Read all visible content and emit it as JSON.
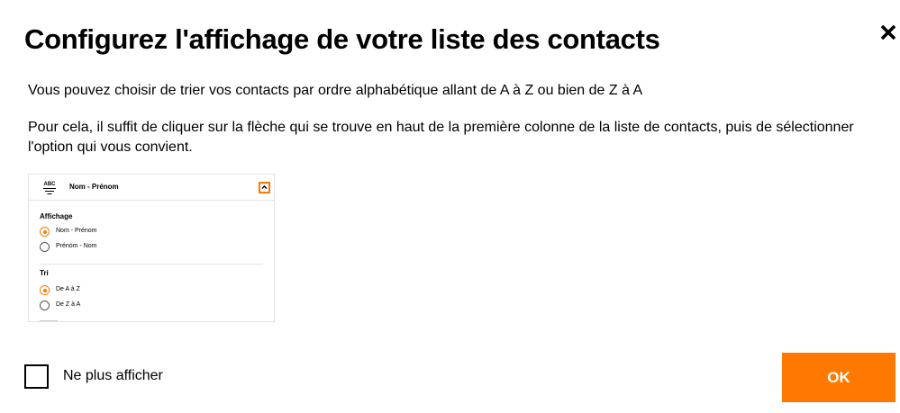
{
  "dialog": {
    "title": "Configurez l'affichage de votre liste des contacts",
    "close_icon": "close-icon",
    "paragraph1": "Vous pouvez choisir de trier vos contacts par ordre alphabétique allant de A à Z ou bien de Z à A",
    "paragraph2": "Pour cela, il suffit de cliquer sur la flèche qui se trouve en haut de la première colonne de la liste de contacts, puis de sélectionner l'option qui vous convient."
  },
  "illustration": {
    "sort_icon_text": "ABC",
    "header_label": "Nom - Prénom",
    "chevron_icon": "chevron-up-icon",
    "highlight_color": "#ff7900",
    "affichage": {
      "label": "Affichage",
      "options": [
        {
          "label": "Nom - Prénom",
          "selected": true
        },
        {
          "label": "Prénom - Nom",
          "selected": false
        }
      ]
    },
    "tri": {
      "label": "Tri",
      "options": [
        {
          "label": "De A à Z",
          "selected": true
        },
        {
          "label": "De Z à A",
          "selected": false
        }
      ]
    }
  },
  "footer": {
    "checkbox_label": "Ne plus afficher",
    "checkbox_checked": false,
    "ok_label": "OK",
    "accent_color": "#ff7900"
  }
}
